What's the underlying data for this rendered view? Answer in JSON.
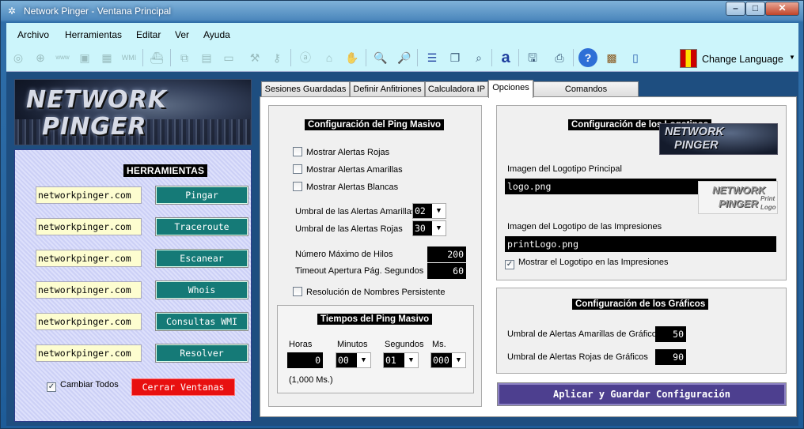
{
  "window": {
    "title": "Network Pinger - Ventana Principal"
  },
  "menu": [
    "Archivo",
    "Herramientas",
    "Editar",
    "Ver",
    "Ayuda"
  ],
  "language": {
    "label": "Change Language"
  },
  "banner": {
    "line1": "NETWORK",
    "line2": "PINGER"
  },
  "tools": {
    "header": "HERRAMIENTAS",
    "rows": [
      {
        "host": "networkpinger.com",
        "button": "Pingar"
      },
      {
        "host": "networkpinger.com",
        "button": "Traceroute"
      },
      {
        "host": "networkpinger.com",
        "button": "Escanear"
      },
      {
        "host": "networkpinger.com",
        "button": "Whois"
      },
      {
        "host": "networkpinger.com",
        "button": "Consultas WMI"
      },
      {
        "host": "networkpinger.com",
        "button": "Resolver"
      }
    ],
    "cambiar_todos": "Cambiar Todos",
    "cambiar_todos_checked": true,
    "cerrar": "Cerrar Ventanas"
  },
  "tabs": [
    "Sesiones Guardadas",
    "Definir Anfitriones",
    "Calculadora IP",
    "Opciones",
    "Comandos Personalizados"
  ],
  "active_tab": "Opciones",
  "ping_masivo": {
    "header": "Configuración del Ping Masivo",
    "alerts": [
      {
        "label": "Mostrar Alertas Rojas",
        "checked": false
      },
      {
        "label": "Mostrar Alertas Amarillas",
        "checked": false
      },
      {
        "label": "Mostrar Alertas Blancas",
        "checked": false
      }
    ],
    "umbral_amarillas_label": "Umbral de las Alertas Amarillas",
    "umbral_amarillas": "02",
    "umbral_rojas_label": "Umbral de las Alertas Rojas",
    "umbral_rojas": "30",
    "hilos_label": "Número Máximo de Hilos",
    "hilos": "200",
    "timeout_label": "Timeout Apertura Pág. Segundos",
    "timeout": "60",
    "resolucion_label": "Resolución de Nombres Persistente",
    "resolucion_checked": false,
    "tiempos": {
      "header": "Tiempos del Ping Masivo",
      "horas_label": "Horas",
      "horas": "0",
      "minutos_label": "Minutos",
      "minutos": "00",
      "segundos_label": "Segundos",
      "segundos": "01",
      "ms_label": "Ms.",
      "ms": "000",
      "note": "(1,000 Ms.)"
    }
  },
  "logotipos": {
    "header": "Configuración de los Logotipos",
    "principal_label": "Imagen del Logotipo Principal",
    "principal_file": "logo.png",
    "principal_logo": {
      "line1": "NETWORK",
      "line2": "PINGER"
    },
    "impresiones_label": "Imagen del Logotipo de las Impresiones",
    "impresiones_file": "printLogo.png",
    "print_logo": {
      "line1": "NETWORK",
      "line2": "PINGER",
      "print": "Print",
      "logo": "Logo"
    },
    "mostrar_label": "Mostrar el Logotipo en las Impresiones",
    "mostrar_checked": true
  },
  "graficos": {
    "header": "Configuración de los Gráficos",
    "amarillas_label": "Umbral de Alertas Amarillas de Gráficos",
    "amarillas": "50",
    "rojas_label": "Umbral de Alertas Rojas de Gráficos",
    "rojas": "90"
  },
  "apply_button": "Aplicar y Guardar Configuración",
  "colors": {
    "menubar": "#ccf5fb",
    "tool_button": "#157a77",
    "close_button": "#e81010",
    "apply_button": "#4d3f8f",
    "background": "#1e4e80"
  },
  "toolbar_icons": [
    "ping-icon",
    "search-icon",
    "www-icon",
    "chart-icon",
    "grid-icon",
    "wmi-icon",
    "ship-icon",
    "network-icon",
    "image-icon",
    "monitor-icon",
    "wrench-icon",
    "plug-icon",
    "a-icon",
    "bank-icon",
    "glove-icon",
    "zoom-in-icon",
    "zoom-out-icon",
    "server-icon",
    "document-icon",
    "zoom-icon",
    "font-icon",
    "save-icon",
    "print-icon",
    "help-icon",
    "toolbox-icon",
    "exit-icon"
  ]
}
